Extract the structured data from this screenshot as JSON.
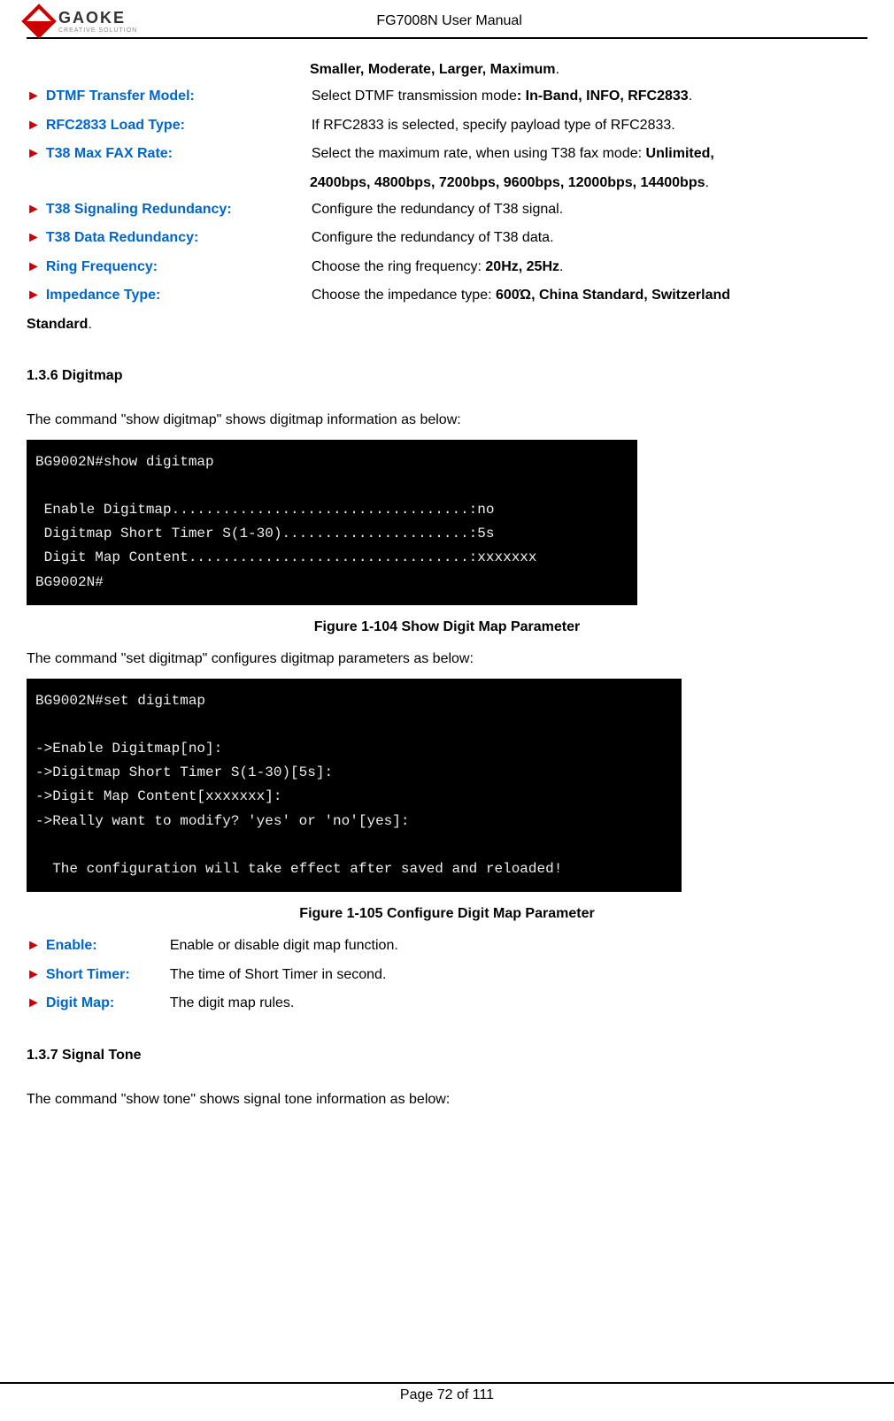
{
  "header": {
    "logo_text": "GAOKE",
    "logo_subtext": "CREATIVE SOLUTION",
    "title": "FG7008N User Manual"
  },
  "top_continuation": "Smaller, Moderate, Larger, Maximum",
  "params_top": [
    {
      "label": "DTMF Transfer Model:",
      "desc_pre": "Select DTMF transmission mode",
      "desc_bold": ": In-Band, INFO, RFC2833",
      "desc_post": "."
    },
    {
      "label": "RFC2833 Load Type:",
      "desc_pre": "If RFC2833 is selected, specify payload type of RFC2833.",
      "desc_bold": "",
      "desc_post": ""
    },
    {
      "label": "T38 Max FAX Rate:",
      "desc_pre": "Select the maximum rate, when using T38 fax mode: ",
      "desc_bold": "Unlimited,",
      "desc_post": ""
    }
  ],
  "t38_rate_line2": "2400bps, 4800bps, 7200bps, 9600bps, 12000bps, 14400bps",
  "params_mid": [
    {
      "label": "T38 Signaling Redundancy:",
      "desc": "Configure the redundancy of T38 signal."
    },
    {
      "label": "T38 Data Redundancy:",
      "desc": "Configure the redundancy of T38 data."
    }
  ],
  "ring_freq": {
    "label": "Ring Frequency:",
    "desc_pre": "Choose the ring frequency: ",
    "desc_bold": "20Hz, 25Hz"
  },
  "impedance": {
    "label": "Impedance Type:",
    "desc_pre": "Choose the impedance type: ",
    "desc_bold": "600Ώ, China Standard, Switzerland",
    "line2_bold": "Standard"
  },
  "section_digitmap": {
    "heading": "1.3.6    Digitmap",
    "intro": "The command \"show digitmap\" shows digitmap information as below:",
    "terminal1": "BG9002N#show digitmap\n\n Enable Digitmap...................................:no\n Digitmap Short Timer S(1-30)......................:5s\n Digit Map Content.................................:xxxxxxx\nBG9002N#",
    "fig1_caption": "Figure 1-104 Show Digit Map Parameter",
    "intro2": "The command \"set digitmap\" configures digitmap parameters as below:",
    "terminal2": "BG9002N#set digitmap\n\n->Enable Digitmap[no]:\n->Digitmap Short Timer S(1-30)[5s]:\n->Digit Map Content[xxxxxxx]:\n->Really want to modify? 'yes' or 'no'[yes]:\n\n  The configuration will take effect after saved and reloaded!",
    "fig2_caption": "Figure 1-105 Configure Digit Map Parameter"
  },
  "params_digitmap": [
    {
      "label": "Enable:",
      "desc": "Enable or disable digit map function."
    },
    {
      "label": "Short Timer:",
      "desc": "The time of Short Timer in second."
    },
    {
      "label": "Digit Map:",
      "desc": "The digit map rules."
    }
  ],
  "section_tone": {
    "heading": "1.3.7    Signal Tone",
    "intro": "The command \"show tone\" shows signal tone information as below:"
  },
  "footer": "Page 72 of 111"
}
